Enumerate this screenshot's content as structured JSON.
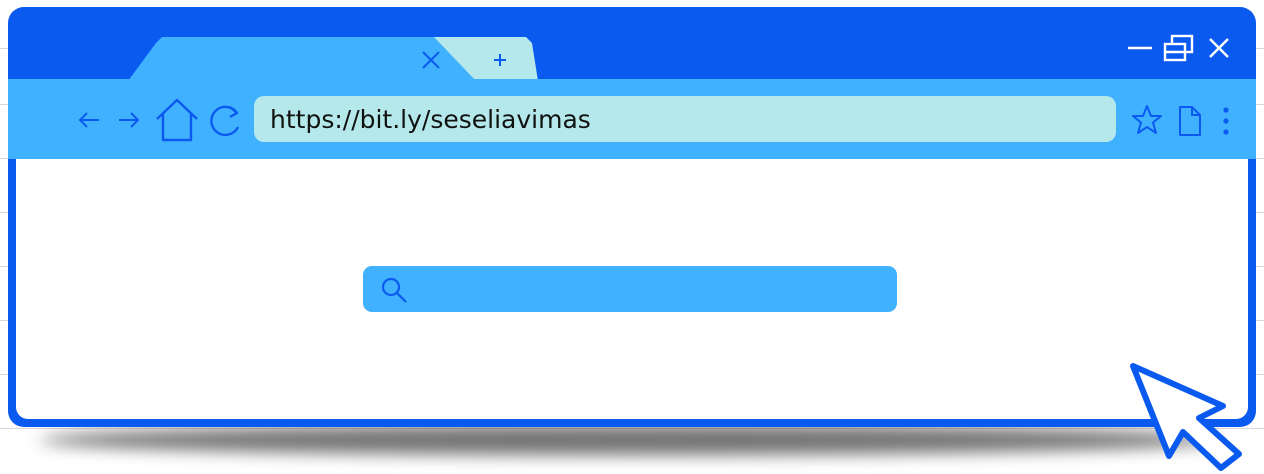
{
  "browser": {
    "address_bar": {
      "url": "https://bit.ly/seseliavimas"
    },
    "tabs": {
      "close_icon": "close-icon",
      "new_tab_icon": "plus-icon"
    },
    "window_controls": [
      "minimize-icon",
      "restore-icon",
      "close-icon"
    ],
    "nav_icons": [
      "back-arrow-icon",
      "forward-arrow-icon",
      "home-icon",
      "reload-icon"
    ],
    "toolbar_icons": [
      "star-icon",
      "page-icon",
      "kebab-menu-icon"
    ]
  },
  "content": {
    "search": {
      "icon": "search-icon",
      "placeholder": ""
    }
  },
  "colors": {
    "frame": "#0b5af0",
    "toolbar": "#3fb1ff",
    "address_bar": "#b4e8ea",
    "content": "#ffffff"
  }
}
